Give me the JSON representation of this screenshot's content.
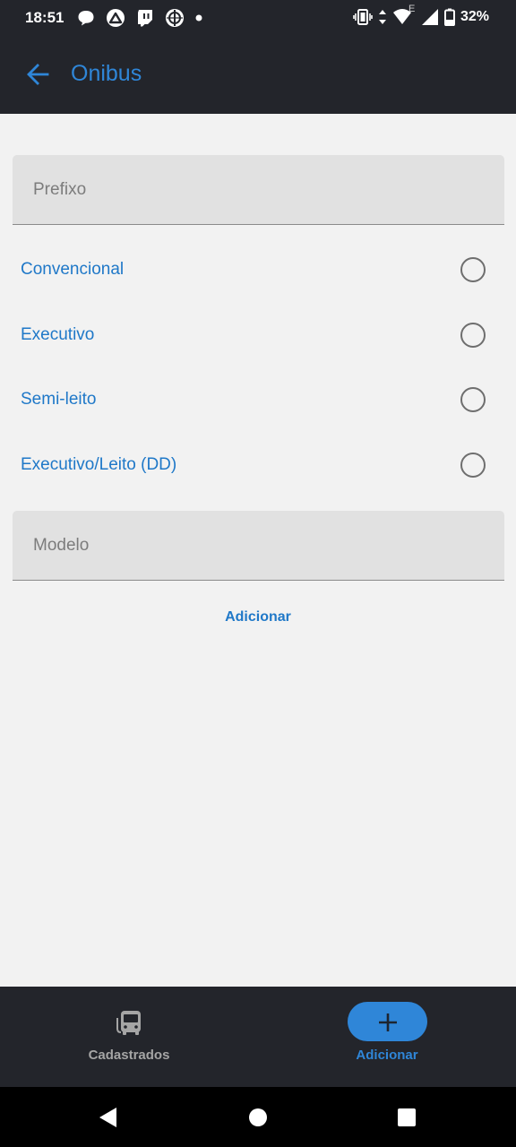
{
  "status_bar": {
    "time": "18:51",
    "battery": "32%",
    "network_badge": "E",
    "left_icons": [
      "chat-bubble-icon",
      "expo-icon",
      "twitch-icon",
      "target-app-icon",
      "notification-dot-icon"
    ],
    "right_icons": [
      "vibrate-icon",
      "data-arrows-icon",
      "wifi-icon",
      "signal-icon",
      "battery-icon"
    ]
  },
  "app_bar": {
    "title": "Onibus",
    "back_icon": "arrow-left-icon",
    "accent_color": "#2f86d8"
  },
  "form": {
    "prefixo": {
      "placeholder": "Prefixo",
      "value": ""
    },
    "bus_types": [
      {
        "label": "Convencional",
        "selected": false
      },
      {
        "label": "Executivo",
        "selected": false
      },
      {
        "label": "Semi-leito",
        "selected": false
      },
      {
        "label": "Executivo/Leito (DD)",
        "selected": false
      }
    ],
    "modelo": {
      "placeholder": "Modelo",
      "value": ""
    },
    "submit_label": "Adicionar"
  },
  "bottom_nav": {
    "items": [
      {
        "label": "Cadastrados",
        "icon": "bus-icon",
        "active": false
      },
      {
        "label": "Adicionar",
        "icon": "plus-icon",
        "active": true
      }
    ]
  },
  "system_nav": {
    "buttons": [
      "back-triangle-icon",
      "home-circle-icon",
      "recents-square-icon"
    ]
  }
}
